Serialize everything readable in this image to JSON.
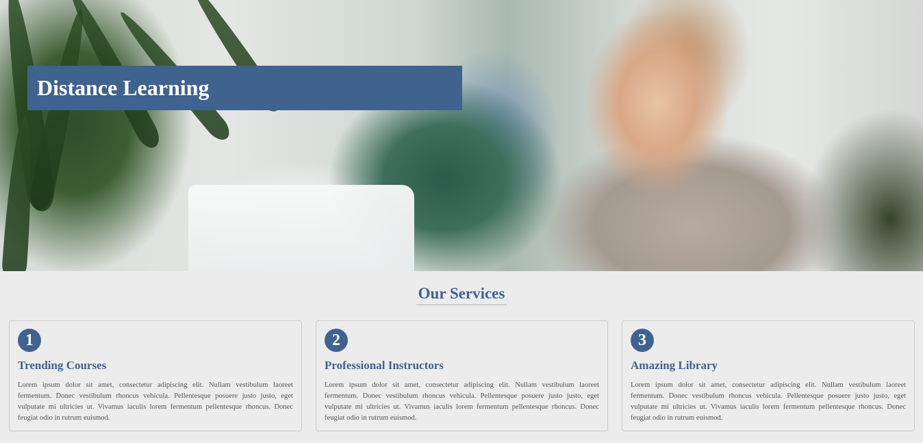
{
  "hero": {
    "title": "Distance Learning"
  },
  "services": {
    "heading": "Our Services",
    "cards": [
      {
        "number": "1",
        "title": "Trending Courses",
        "text": "Lorem ipsum dolor sit amet, consectetur adipiscing elit. Nullam vestibulum laoreet fermentum. Donec vestibulum rhoncus vehicula. Pellentesque posuere justo justo, eget vulputate mi ultricies ut. Vivamus iaculis lorem fermentum pellentesque rhoncus. Donec feugiat odio in rutrum euismod."
      },
      {
        "number": "2",
        "title": "Professional Instructors",
        "text": "Lorem ipsum dolor sit amet, consectetur adipiscing elit. Nullam vestibulum laoreet fermentum. Donec vestibulum rhoncus vehicula. Pellentesque posuere justo justo, eget vulputate mi ultricies ut. Vivamus iaculis lorem fermentum pellentesque rhoncus. Donec feugiat odio in rutrum euismod."
      },
      {
        "number": "3",
        "title": "Amazing Library",
        "text": "Lorem ipsum dolor sit amet, consectetur adipiscing elit. Nullam vestibulum laoreet fermentum. Donec vestibulum rhoncus vehicula. Pellentesque posuere justo justo, eget vulputate mi ultricies ut. Vivamus iaculis lorem fermentum pellentesque rhoncus. Donec feugiat odio in rutrum euismod."
      }
    ]
  },
  "colors": {
    "accent": "#40628f",
    "page_background": "#ececec",
    "body_text": "#555555"
  }
}
